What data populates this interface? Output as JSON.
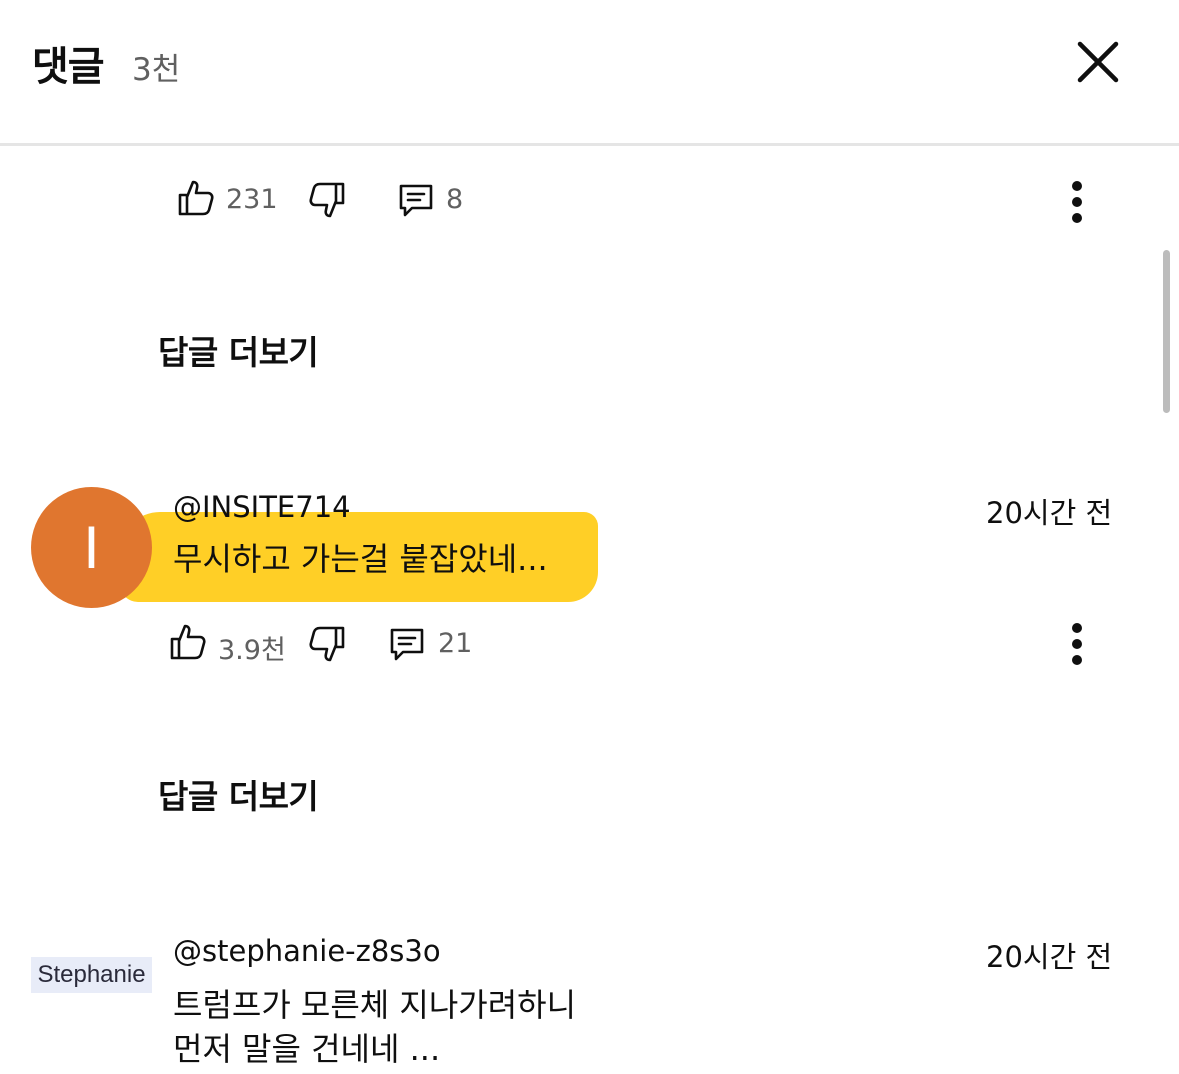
{
  "header": {
    "title": "댓글",
    "count": "3천"
  },
  "comments": [
    {
      "likes": "231",
      "replies": "8",
      "view_replies": "답글 더보기"
    },
    {
      "avatar_letter": "I",
      "author": "@INSITE714",
      "time": "20시간 전",
      "text": "무시하고 가는걸 붙잡았네...",
      "likes": "3.9천",
      "replies": "21",
      "view_replies": "답글 더보기"
    },
    {
      "avatar_text": "Stephanie",
      "author": "@stephanie-z8s3o",
      "time": "20시간 전",
      "text_line1": "트럼프가 모른체 지나가려하니",
      "text_line2": "먼저 말을 건네네 ..."
    }
  ],
  "icons": [
    "close-icon",
    "thumbs-up-icon",
    "thumbs-down-icon",
    "reply-icon",
    "more-vert-icon"
  ],
  "colors": {
    "highlight": "#ffcc1a",
    "avatar": "#e0762f",
    "secondary_text": "#606060"
  }
}
